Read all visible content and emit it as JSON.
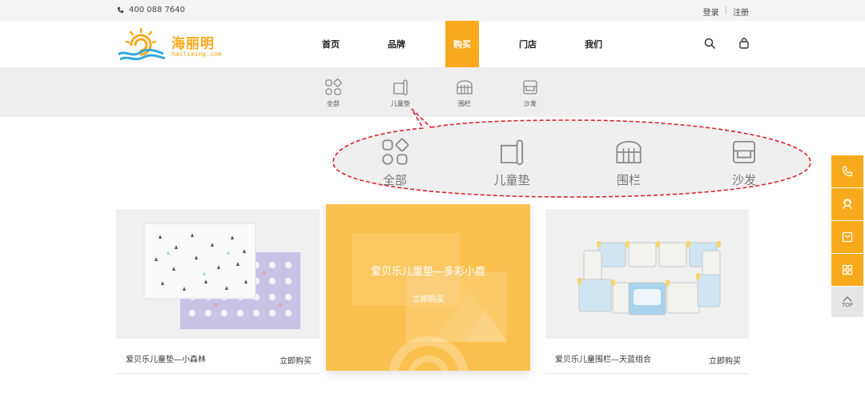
{
  "topbar": {
    "phone": "400 088 7640",
    "login": "登录",
    "register": "注册"
  },
  "logo": {
    "name": "海丽明",
    "domain": "hailiming.com"
  },
  "nav": {
    "items": [
      "首页",
      "品牌",
      "购买",
      "门店",
      "我们"
    ],
    "active": "购买"
  },
  "subnav": {
    "items": [
      "全部",
      "儿童垫",
      "围栏",
      "沙发"
    ]
  },
  "callout": {
    "items": [
      "全部",
      "儿童垫",
      "围栏",
      "沙发"
    ]
  },
  "products": [
    {
      "name": "爱贝乐儿童垫—小森林",
      "buy": "立即购买"
    },
    {
      "name": "爱贝乐儿童垫—多彩小鹿",
      "buy": "立即购买"
    },
    {
      "name": "爱贝乐儿童围栏—天蓝组合",
      "buy": "立即购买"
    }
  ],
  "side": {
    "top_label": "TOP"
  },
  "colors": {
    "accent": "#f8aa1c",
    "callout_border": "#d9232d"
  }
}
